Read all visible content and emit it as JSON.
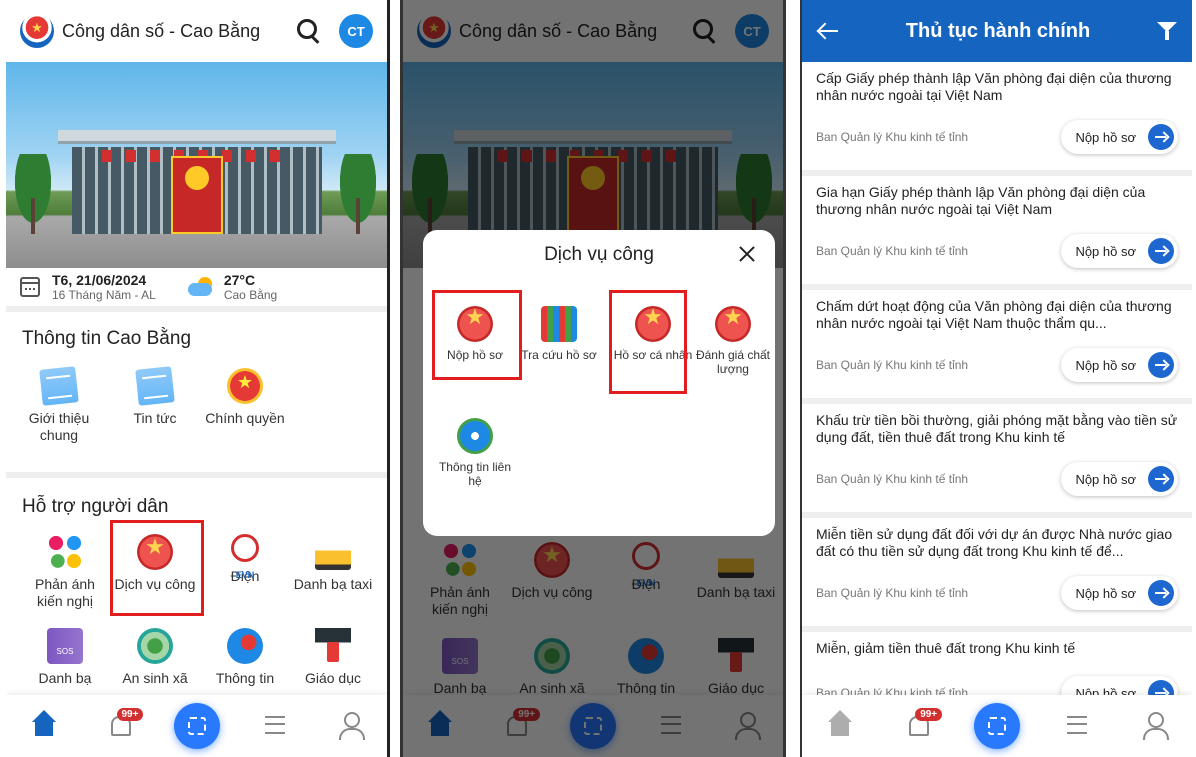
{
  "header": {
    "app_title": "Công dân số - Cao Bằng",
    "avatar_initials": "CT"
  },
  "weather": {
    "date": "T6, 21/06/2024",
    "lunar": "16 Tháng Năm - AL",
    "temperature": "27°C",
    "location": "Cao Bằng"
  },
  "info_section": {
    "title": "Thông tin Cao Bằng",
    "items": [
      {
        "label": "Giới thiệu chung",
        "icon": "news-icon"
      },
      {
        "label": "Tin tức",
        "icon": "news-icon"
      },
      {
        "label": "Chính quyền",
        "icon": "emblem-icon"
      }
    ]
  },
  "support_section": {
    "title": "Hỗ trợ người dân",
    "items": [
      {
        "label": "Phản ánh kiến nghị",
        "icon": "feedback-icon"
      },
      {
        "label": "Dịch vụ công",
        "icon": "public-service-icon"
      },
      {
        "label": "Điện",
        "icon": "evn-icon"
      },
      {
        "label": "Danh bạ taxi",
        "icon": "taxi-icon"
      },
      {
        "label": "Danh bạ",
        "icon": "sos-book-icon"
      },
      {
        "label": "An sinh xã",
        "icon": "social-welfare-icon"
      },
      {
        "label": "Thông tin",
        "icon": "info-megaphone-icon"
      },
      {
        "label": "Giáo dục",
        "icon": "education-icon"
      }
    ]
  },
  "bottom_nav": {
    "notification_badge": "99+",
    "items": [
      "home-icon",
      "bell-icon",
      "qr-scan-icon",
      "settings-sliders-icon",
      "user-icon"
    ]
  },
  "modal": {
    "title": "Dịch vụ công",
    "items": [
      {
        "label": "Nộp hồ sơ",
        "icon": "star-emblem-icon"
      },
      {
        "label": "Tra cứu hồ sơ",
        "icon": "shelf-icon"
      },
      {
        "label": "Hồ sơ cá nhân",
        "icon": "star-emblem-icon"
      },
      {
        "label": "Đánh giá chất lượng",
        "icon": "star-emblem-icon"
      },
      {
        "label": "Thông tin liên hệ",
        "icon": "contact-info-icon"
      }
    ]
  },
  "procedures": {
    "title": "Thủ tục hành chính",
    "submit_label": "Nộp hồ sơ",
    "items": [
      {
        "name": "Cấp Giấy phép thành lập Văn phòng đại diện của thương nhân nước ngoài tại Việt Nam",
        "org": "Ban Quản lý Khu kinh tế tỉnh"
      },
      {
        "name": "Gia hạn Giấy phép thành lập Văn phòng đại diện của thương nhân nước ngoài tại Việt Nam",
        "org": "Ban Quản lý Khu kinh tế tỉnh"
      },
      {
        "name": "Chấm dứt hoạt động của Văn phòng đại diện của thương nhân nước ngoài tại Việt Nam thuộc thẩm qu...",
        "org": "Ban Quản lý Khu kinh tế tỉnh"
      },
      {
        "name": "Khấu trừ tiền bồi thường, giải phóng mặt bằng vào tiền sử dụng đất, tiền thuê đất trong Khu kinh tế",
        "org": "Ban Quản lý Khu kinh tế tỉnh"
      },
      {
        "name": "Miễn tiền sử dụng đất đối với dự án được Nhà nước giao đất có thu tiền sử dụng đất trong Khu kinh tế để...",
        "org": "Ban Quản lý Khu kinh tế tỉnh"
      },
      {
        "name": "Miễn, giảm tiền thuê đất trong Khu kinh tế",
        "org": "Ban Quản lý Khu kinh tế tỉnh"
      }
    ]
  }
}
